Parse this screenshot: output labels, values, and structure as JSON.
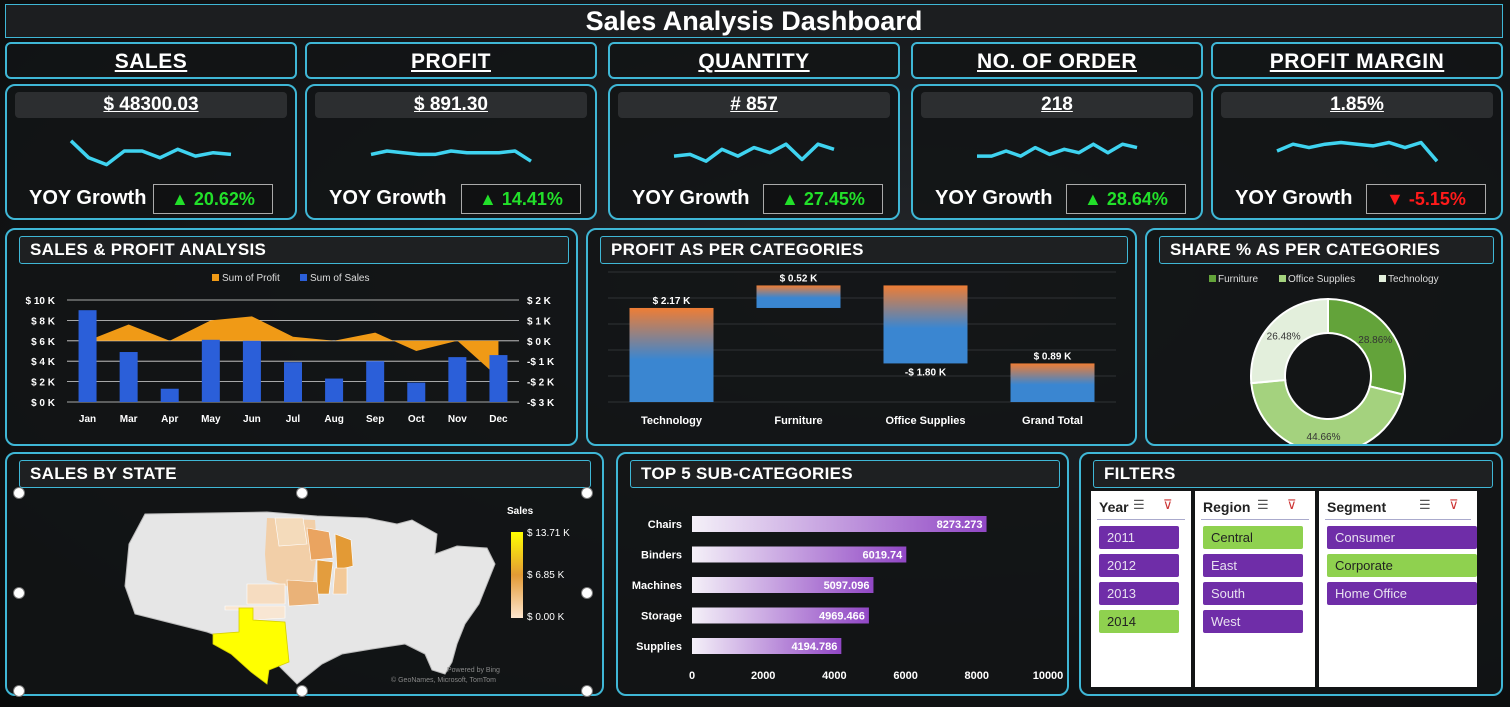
{
  "title": "Sales Analysis Dashboard",
  "kpis": [
    {
      "header": "SALES",
      "value": "$ 48300.03",
      "yoy_label": "YOY Growth",
      "yoy": "20.62%",
      "dir": "up",
      "spark": [
        0.8,
        0.3,
        0.1,
        0.5,
        0.5,
        0.3,
        0.55,
        0.35,
        0.45,
        0.4
      ]
    },
    {
      "header": "PROFIT",
      "value": "$ 891.30",
      "yoy_label": "YOY Growth",
      "yoy": "14.41%",
      "dir": "up",
      "spark": [
        0.4,
        0.5,
        0.45,
        0.4,
        0.4,
        0.5,
        0.45,
        0.45,
        0.45,
        0.5,
        0.2
      ]
    },
    {
      "header": "QUANTITY",
      "value": "# 857",
      "yoy_label": "YOY Growth",
      "yoy": "27.45%",
      "dir": "up",
      "spark": [
        0.35,
        0.4,
        0.2,
        0.55,
        0.35,
        0.6,
        0.45,
        0.7,
        0.25,
        0.7,
        0.55
      ]
    },
    {
      "header": "NO. OF ORDER",
      "value": "218",
      "yoy_label": "YOY Growth",
      "yoy": "28.64%",
      "dir": "up",
      "spark": [
        0.35,
        0.35,
        0.5,
        0.35,
        0.6,
        0.4,
        0.55,
        0.45,
        0.7,
        0.45,
        0.7,
        0.6
      ]
    },
    {
      "header": "PROFIT MARGIN",
      "value": "1.85%",
      "yoy_label": "YOY Growth",
      "yoy": "-5.15%",
      "dir": "down",
      "spark": [
        0.5,
        0.7,
        0.6,
        0.7,
        0.75,
        0.7,
        0.65,
        0.75,
        0.6,
        0.75,
        0.2
      ]
    }
  ],
  "sections": {
    "sales_profit": "SALES & PROFIT ANALYSIS",
    "profit_cat": "PROFIT AS PER CATEGORIES",
    "share_cat": "SHARE % AS PER CATEGORIES",
    "sales_state": "SALES BY STATE",
    "top5": "TOP 5 SUB-CATEGORIES",
    "filters": "FILTERS"
  },
  "colors": {
    "accent": "#3fb7d6",
    "sales": "#2b5fd9",
    "profit": "#f09a16",
    "up": "#22e02a",
    "down": "#ff1a1a",
    "slicer_on": "#8fd14f",
    "slicer_off": "#6f2da8"
  },
  "chart_data": [
    {
      "type": "bar",
      "id": "sales_profit",
      "categories": [
        "Jan",
        "Mar",
        "Apr",
        "May",
        "Jun",
        "Jul",
        "Aug",
        "Sep",
        "Oct",
        "Nov",
        "Dec"
      ],
      "series": [
        {
          "name": "Sum of Profit",
          "type": "area",
          "axis": "right",
          "values": [
            0,
            800,
            0,
            1000,
            1200,
            200,
            0,
            400,
            -500,
            0,
            -1800
          ]
        },
        {
          "name": "Sum of Sales",
          "type": "bar",
          "axis": "left",
          "values": [
            9000,
            4900,
            1300,
            6100,
            6000,
            3900,
            2300,
            4000,
            1900,
            4400,
            4600
          ]
        }
      ],
      "y_left_ticks": [
        "$ 10 K",
        "$ 8 K",
        "$ 6 K",
        "$ 4 K",
        "$ 2 K",
        "$ 0 K"
      ],
      "y_right_ticks": [
        "$ 2 K",
        "$ 1 K",
        "$ 0 K",
        "-$ 1 K",
        "-$ 2 K",
        "-$ 3 K"
      ],
      "ylim_left": [
        0,
        10000
      ],
      "ylim_right": [
        -3000,
        2000
      ]
    },
    {
      "type": "bar",
      "id": "profit_cat",
      "subtype": "waterfall",
      "categories": [
        "Technology",
        "Furniture",
        "Office Supplies",
        "Grand Total"
      ],
      "values": [
        2.17,
        0.52,
        -1.8,
        0.89
      ],
      "labels": [
        "$ 2.17 K",
        "$ 0.52 K",
        "-$ 1.80 K",
        "$ 0.89 K"
      ],
      "ylim": [
        0,
        3.0
      ]
    },
    {
      "type": "pie",
      "id": "share_cat",
      "legend": [
        "Furniture",
        "Office Supplies",
        "Technology"
      ],
      "values": [
        28.86,
        44.66,
        26.48
      ],
      "labels": [
        "28.86%",
        "44.66%",
        "26.48%"
      ],
      "slice_colors": [
        "#63a33a",
        "#a4d27e",
        "#e3efdc"
      ]
    },
    {
      "type": "bar",
      "id": "top5",
      "orientation": "horizontal",
      "categories": [
        "Chairs",
        "Binders",
        "Machines",
        "Storage",
        "Supplies"
      ],
      "values": [
        8273.273,
        6019.74,
        5097.096,
        4969.466,
        4194.786
      ],
      "labels": [
        "8273.273",
        "6019.74",
        "5097.096",
        "4969.466",
        "4194.786"
      ],
      "x_ticks": [
        "0",
        "2000",
        "4000",
        "6000",
        "8000",
        "10000"
      ],
      "xlim": [
        0,
        10000
      ]
    }
  ],
  "map": {
    "legend_title": "Sales",
    "legend_ticks": [
      "$ 13.71 K",
      "$ 6.85 K",
      "$ 0.00 K"
    ],
    "credit1": "Powered by Bing",
    "credit2": "© GeoNames, Microsoft, TomTom"
  },
  "filters": {
    "year": {
      "label": "Year",
      "items": [
        {
          "t": "2011",
          "on": false
        },
        {
          "t": "2012",
          "on": false
        },
        {
          "t": "2013",
          "on": false
        },
        {
          "t": "2014",
          "on": true
        }
      ]
    },
    "region": {
      "label": "Region",
      "items": [
        {
          "t": "Central",
          "on": true
        },
        {
          "t": "East",
          "on": false
        },
        {
          "t": "South",
          "on": false
        },
        {
          "t": "West",
          "on": false
        }
      ]
    },
    "segment": {
      "label": "Segment",
      "items": [
        {
          "t": "Consumer",
          "on": false
        },
        {
          "t": "Corporate",
          "on": true
        },
        {
          "t": "Home Office",
          "on": false
        }
      ]
    }
  }
}
